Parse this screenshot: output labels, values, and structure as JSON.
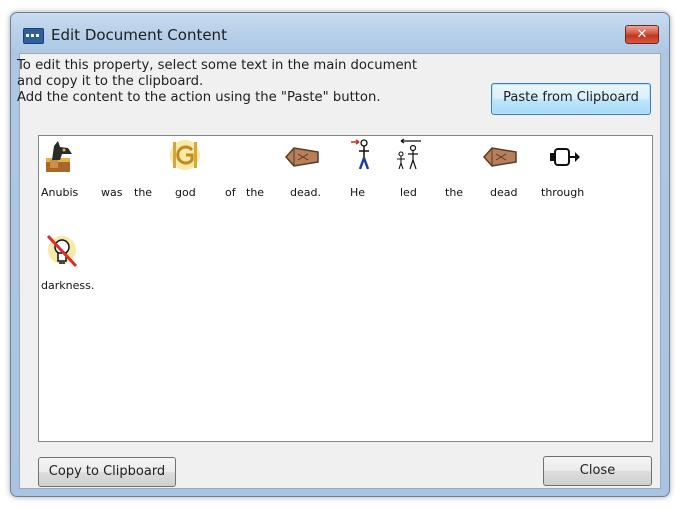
{
  "dialog": {
    "title": "Edit Document Content",
    "close_glyph": "✕",
    "instructions": [
      "To edit this property, select some text in the main document",
      "and copy it to the clipboard.",
      "Add the content to the action using the \"Paste\" button."
    ],
    "paste_button": "Paste from Clipboard",
    "copy_button": "Copy to Clipboard",
    "close_button": "Close"
  },
  "content": {
    "words": [
      "Anubis",
      "was",
      "the",
      "god",
      "of",
      "the",
      "dead.",
      "He",
      "led",
      "the",
      "dead",
      "through",
      "darkness."
    ],
    "symbols": [
      "anubis-icon",
      "god-icon",
      "dead-coffin-icon",
      "he-person-icon",
      "led-people-icon",
      "dead-coffin-icon",
      "through-arrow-icon",
      "darkness-bulb-icon"
    ]
  },
  "colors": {
    "title_bar": "#b7cfe9",
    "close_button": "#c1361f",
    "client_bg": "#f0f0f0",
    "paste_button_focus": "#3c7fb1"
  }
}
